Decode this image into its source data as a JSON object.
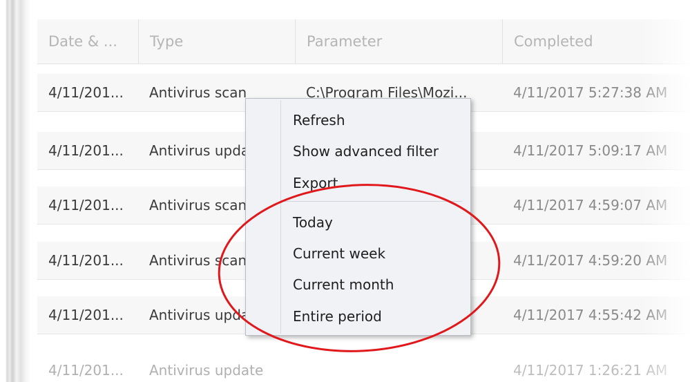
{
  "table": {
    "columns": [
      "Date & ...",
      "Type",
      "Parameter",
      "Completed"
    ],
    "rows": [
      {
        "date": "4/11/201...",
        "type": "Antivirus scan",
        "parameter": "C:\\Program Files\\Mozi...",
        "completed": "4/11/2017 5:27:38 AM"
      },
      {
        "date": "4/11/201...",
        "type": "Antivirus update",
        "parameter": "",
        "completed": "4/11/2017 5:09:17 AM"
      },
      {
        "date": "4/11/201...",
        "type": "Antivirus scan",
        "parameter": "",
        "completed": "4/11/2017 4:59:07 AM"
      },
      {
        "date": "4/11/201...",
        "type": "Antivirus scan",
        "parameter": "",
        "completed": "4/11/2017 4:59:20 AM"
      },
      {
        "date": "4/11/201...",
        "type": "Antivirus update",
        "parameter": "",
        "completed": "4/11/2017 4:55:42 AM"
      },
      {
        "date": "4/11/201...",
        "type": "Antivirus update",
        "parameter": "",
        "completed": "4/11/2017 1:26:21 AM"
      }
    ]
  },
  "context_menu": {
    "items": [
      "Refresh",
      "Show advanced filter",
      "Export",
      "Today",
      "Current week",
      "Current month",
      "Entire period"
    ]
  },
  "colors": {
    "annotation_ellipse": "#e0181b",
    "menu_background": "#f1f2f5",
    "row_background": "#f7f7f7"
  }
}
